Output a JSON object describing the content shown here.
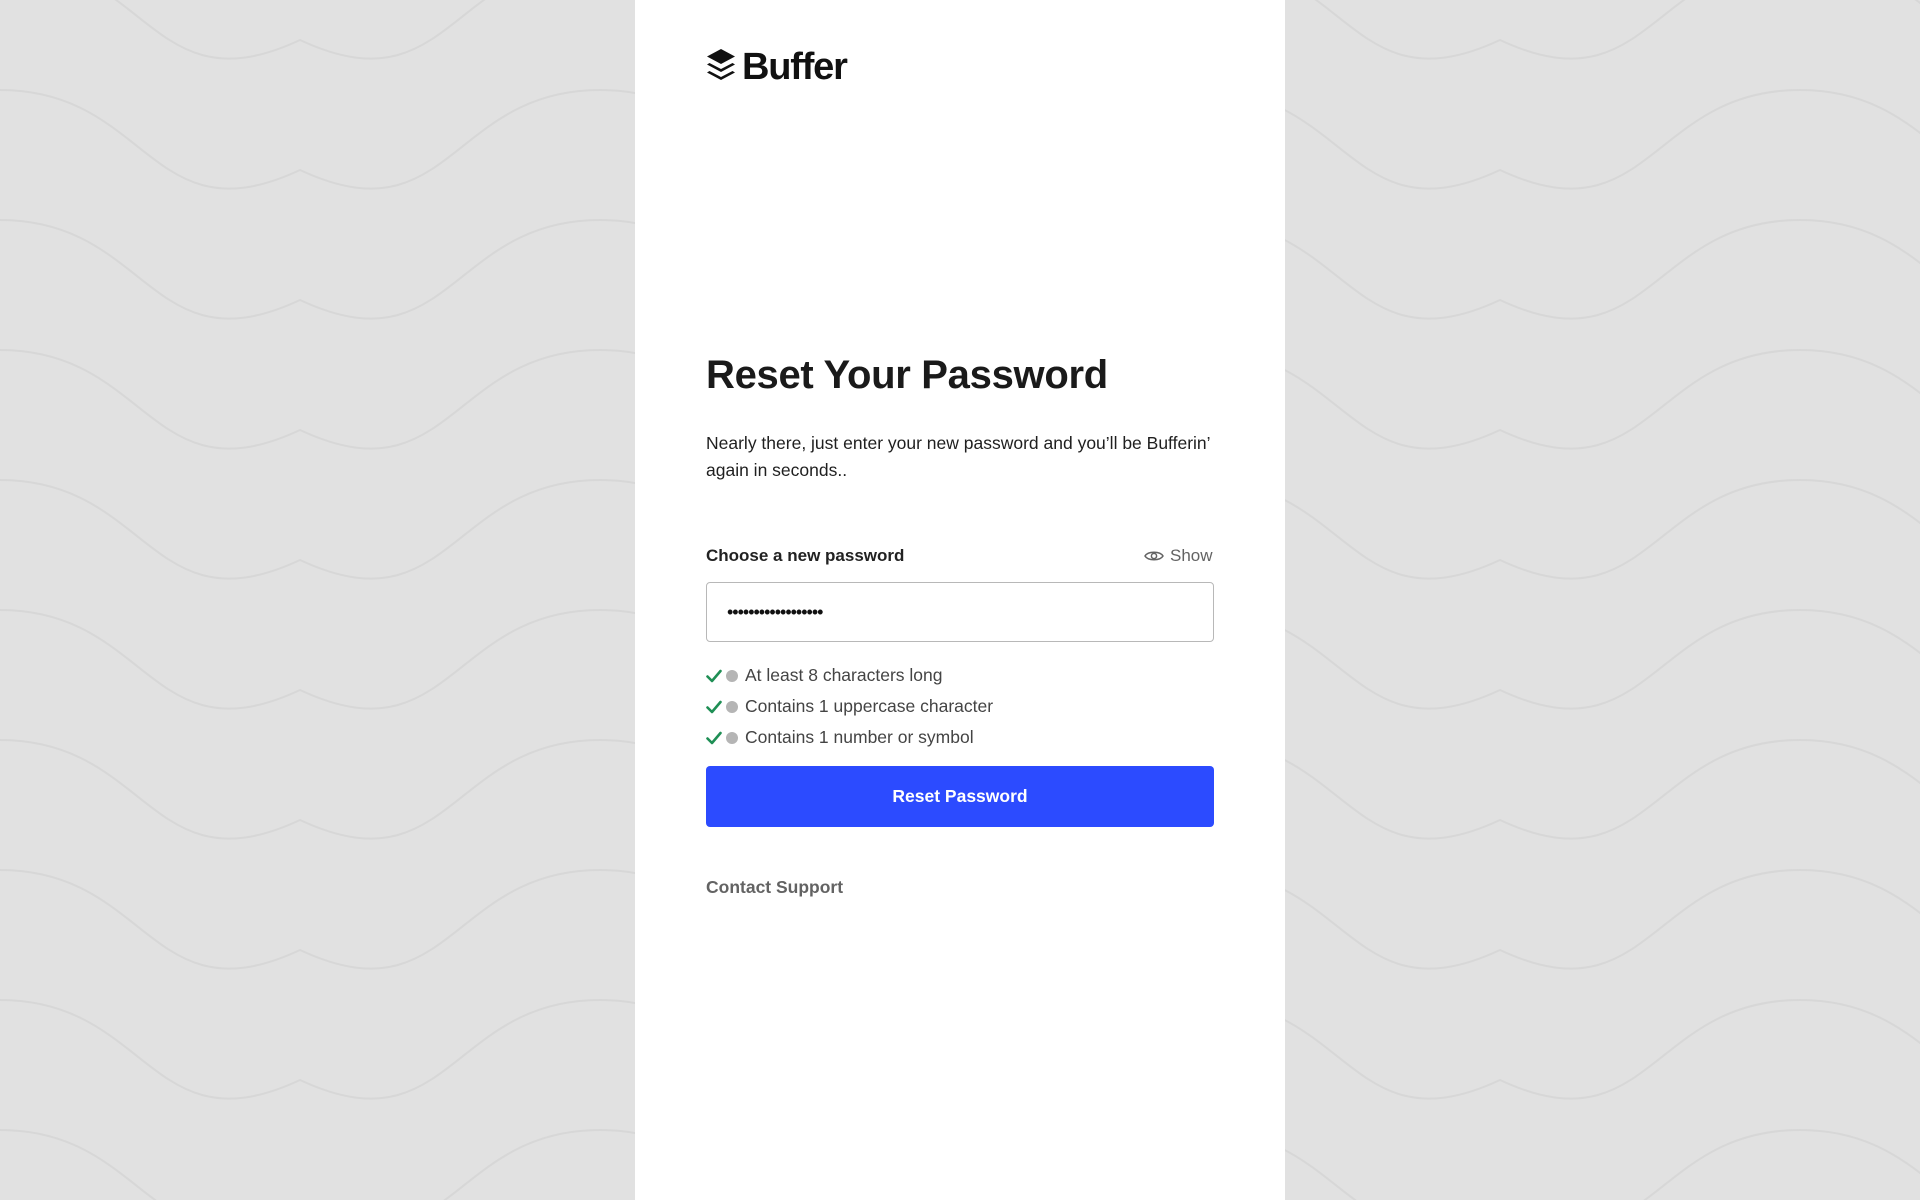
{
  "brand": {
    "name": "Buffer",
    "logo_icon": "buffer-layers-icon"
  },
  "page": {
    "title": "Reset Your Password",
    "subtitle": "Nearly there, just enter your new password and you’ll be Bufferin’ again in seconds.."
  },
  "password_field": {
    "label": "Choose a new password",
    "show_label": "Show",
    "show_icon": "eye-icon",
    "value": "••••••••••••••••••"
  },
  "requirements": [
    {
      "label": "At least 8 characters long",
      "met": true
    },
    {
      "label": "Contains 1 uppercase character",
      "met": true
    },
    {
      "label": "Contains 1 number or symbol",
      "met": true
    }
  ],
  "actions": {
    "reset_label": "Reset Password",
    "contact_label": "Contact Support"
  },
  "colors": {
    "page_background": "#e1e1e1",
    "panel_background": "#ffffff",
    "primary_button": "#2c4bff",
    "check_green": "#1f8f55",
    "muted_text": "#636363"
  }
}
